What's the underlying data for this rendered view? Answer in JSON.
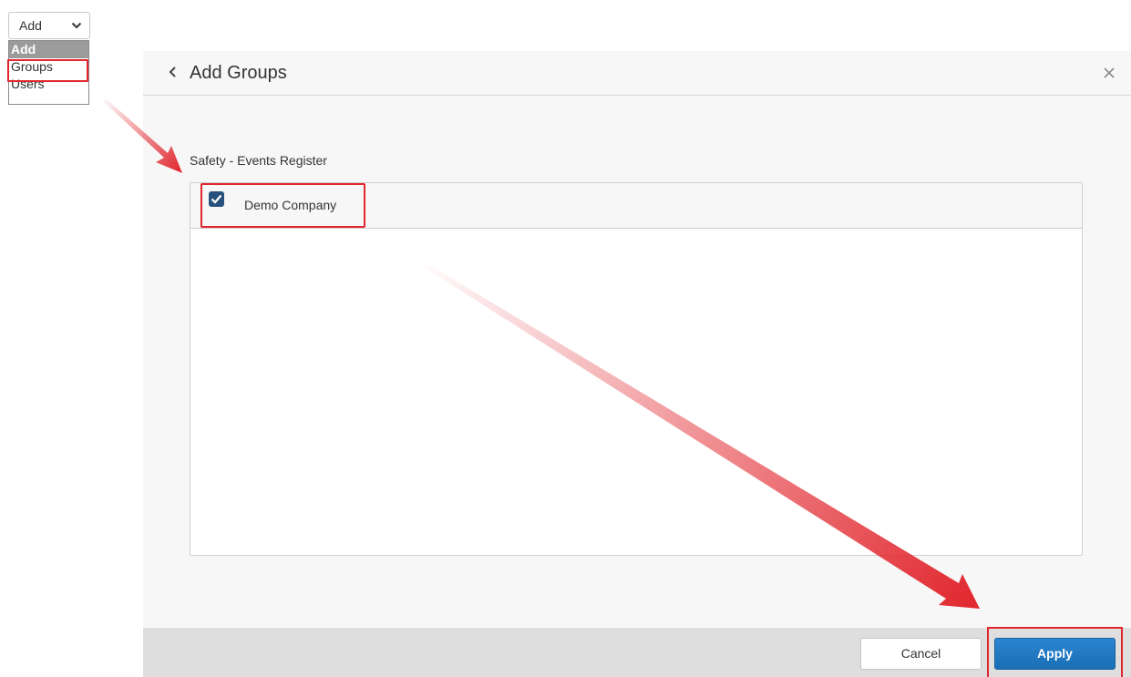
{
  "dropdown": {
    "selected_label": "Add",
    "options": [
      "Add",
      "Groups",
      "Users"
    ]
  },
  "modal": {
    "title": "Add Groups",
    "section_label": "Safety - Events Register",
    "rows": [
      {
        "label": "Demo Company",
        "checked": true
      }
    ],
    "cancel_label": "Cancel",
    "apply_label": "Apply"
  },
  "colors": {
    "annotation_red": "#e1262d",
    "primary_blue": "#1a6fb6",
    "checkbox_blue": "#27527e"
  },
  "icons": {
    "dropdown": "chevron-down-icon",
    "back": "chevron-left-icon",
    "close": "close-icon",
    "check": "check-icon"
  }
}
